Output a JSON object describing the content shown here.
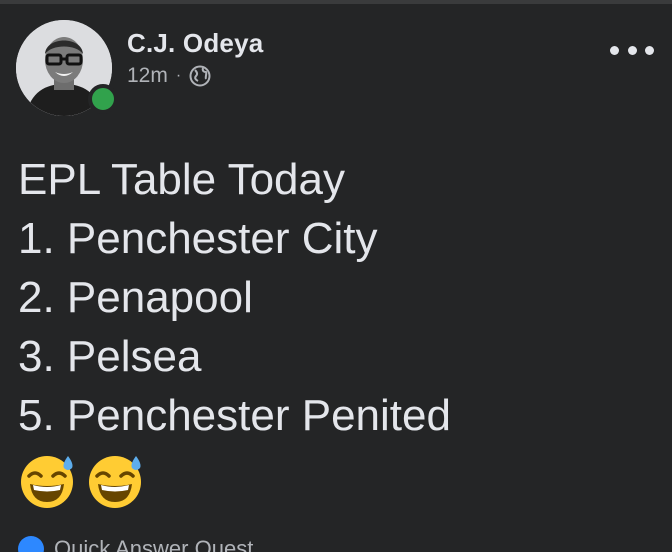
{
  "post": {
    "author": "C.J. Odeya",
    "timestamp": "12m",
    "separator": "·",
    "privacy_icon": "globe-icon",
    "more_icon": "more-options-icon",
    "lines": [
      "EPL Table Today",
      "1. Penchester City",
      "2. Penapool",
      "3. Pelsea",
      "5. Penchester Penited"
    ],
    "emojis": [
      "grinning-face-with-sweat",
      "grinning-face-with-sweat"
    ],
    "footer_text": "Quick Answer Quest"
  },
  "colors": {
    "background": "#242526",
    "text_primary": "#e4e6eb",
    "text_secondary": "#b0b3b8",
    "presence": "#31a24c"
  }
}
